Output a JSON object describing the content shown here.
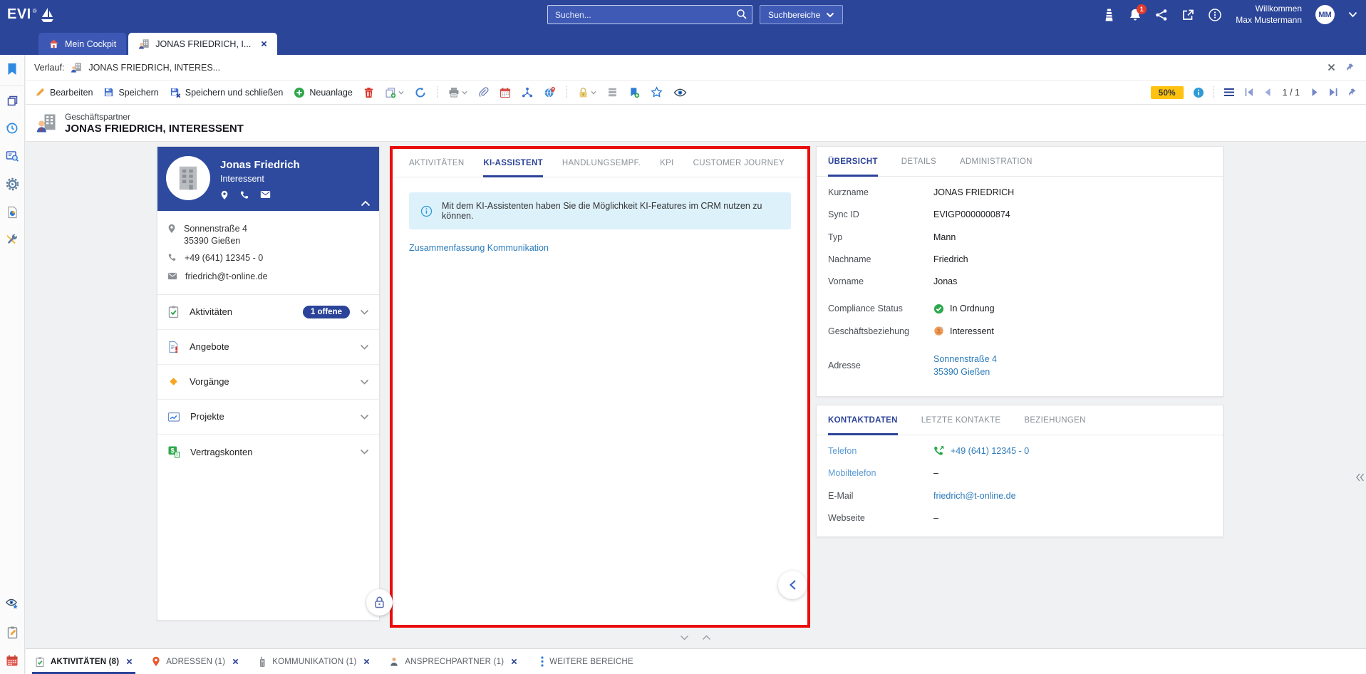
{
  "topbar": {
    "logo_text": "EVI",
    "logo_mark": "®",
    "search": {
      "placeholder": "Suchen...",
      "scope_label": "Suchbereiche"
    },
    "notifications_badge": "1",
    "welcome_line1": "Willkommen",
    "welcome_line2": "Max Mustermann",
    "avatar_initials": "MM"
  },
  "main_tabs": [
    {
      "label": "Mein Cockpit"
    },
    {
      "label": "JONAS FRIEDRICH, I..."
    }
  ],
  "history_bar": {
    "label": "Verlauf:",
    "entry": "JONAS FRIEDRICH, INTERES..."
  },
  "toolbar": {
    "edit_label": "Bearbeiten",
    "save_label": "Speichern",
    "save_close_label": "Speichern und schließen",
    "new_label": "Neuanlage",
    "completeness_badge": "50%",
    "page_indicator": "1 / 1"
  },
  "record_header": {
    "type_label": "Geschäftspartner",
    "title": "JONAS FRIEDRICH, INTERESSENT"
  },
  "profile_card": {
    "name": "Jonas Friedrich",
    "relationship": "Interessent",
    "address_line1": "Sonnenstraße 4",
    "address_line2": "35390 Gießen",
    "phone": "+49 (641) 12345 - 0",
    "email": "friedrich@t-online.de"
  },
  "quick_sections": [
    {
      "label": "Aktivitäten",
      "badge": "1 offene"
    },
    {
      "label": "Angebote"
    },
    {
      "label": "Vorgänge"
    },
    {
      "label": "Projekte"
    },
    {
      "label": "Vertragskonten"
    }
  ],
  "ki_panel": {
    "tabs": [
      {
        "label": "AKTIVITÄTEN"
      },
      {
        "label": "KI-ASSISTENT"
      },
      {
        "label": "HANDLUNGSEMPF."
      },
      {
        "label": "KPI"
      },
      {
        "label": "CUSTOMER JOURNEY"
      }
    ],
    "info_message": "Mit dem KI-Assistenten haben Sie die Möglichkeit KI-Features im CRM nutzen zu können.",
    "link_label": "Zusammenfassung Kommunikation"
  },
  "overview_panel": {
    "tabs": [
      {
        "label": "ÜBERSICHT"
      },
      {
        "label": "DETAILS"
      },
      {
        "label": "ADMINISTRATION"
      }
    ],
    "fields": {
      "kurzname": {
        "label": "Kurzname",
        "value": "JONAS FRIEDRICH"
      },
      "sync_id": {
        "label": "Sync ID",
        "value": "EVIGP0000000874"
      },
      "typ": {
        "label": "Typ",
        "value": "Mann"
      },
      "nachname": {
        "label": "Nachname",
        "value": "Friedrich"
      },
      "vorname": {
        "label": "Vorname",
        "value": "Jonas"
      },
      "compliance": {
        "label": "Compliance Status",
        "value": "In Ordnung"
      },
      "beziehung": {
        "label": "Geschäftsbeziehung",
        "value": "Interessent"
      },
      "adresse": {
        "label": "Adresse",
        "value_line1": "Sonnenstraße 4",
        "value_line2": "35390 Gießen"
      }
    }
  },
  "contact_panel": {
    "tabs": [
      {
        "label": "KONTAKTDATEN"
      },
      {
        "label": "LETZTE KONTAKTE"
      },
      {
        "label": "BEZIEHUNGEN"
      }
    ],
    "fields": {
      "telefon": {
        "label": "Telefon",
        "value": "+49 (641) 12345 - 0"
      },
      "mobil": {
        "label": "Mobiltelefon",
        "value": "–"
      },
      "email": {
        "label": "E-Mail",
        "value": "friedrich@t-online.de"
      },
      "web": {
        "label": "Webseite",
        "value": "–"
      }
    }
  },
  "bottom_tabs": [
    {
      "label": "AKTIVITÄTEN (8)"
    },
    {
      "label": "ADRESSEN (1)"
    },
    {
      "label": "KOMMUNIKATION (1)"
    },
    {
      "label": "ANSPRECHPARTNER (1)"
    },
    {
      "label": "WEITERE BEREICHE"
    }
  ],
  "colors": {
    "topbar_blue": "#2b4599",
    "accent_navy": "#2b4398",
    "card_blue": "#2d4a9e",
    "link_blue": "#2b7bbb",
    "label_light_blue": "#5b9bd5",
    "highlight_red": "#ea0b0b",
    "badge_yellow": "#ffc20e",
    "success_green": "#2da84c",
    "warn_orange": "#f5a623"
  },
  "icons": {
    "topbar": [
      "lighthouse-icon",
      "notifications-bell-icon",
      "share-icon",
      "open-external-icon",
      "more-options-icon"
    ],
    "toolbar": [
      "edit-pencil-icon",
      "save-icon",
      "save-close-icon",
      "add-icon",
      "delete-trash-icon",
      "copy-icon",
      "refresh-icon",
      "print-icon",
      "attachment-icon",
      "calendar-icon",
      "relations-icon",
      "map-icon",
      "lock-icon",
      "rows-icon",
      "bookmark-add-icon",
      "favorite-star-icon",
      "watch-eye-icon",
      "info-icon",
      "menu-icon",
      "pagination-icons",
      "pin-icon"
    ],
    "sidebar": [
      "bookmark-icon",
      "copy-pages-icon",
      "history-icon",
      "card-search-icon",
      "automation-gear-icon",
      "report-pie-icon",
      "tools-icon",
      "watchlist-eye-star-icon",
      "notes-clipboard-icon",
      "calendar-red-icon"
    ]
  }
}
